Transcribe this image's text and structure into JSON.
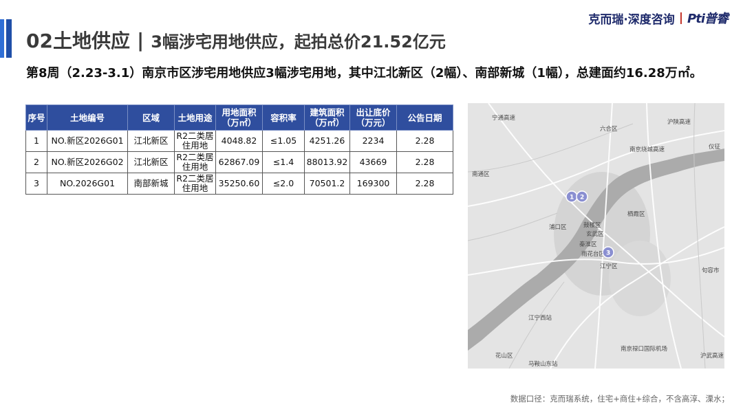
{
  "brand": {
    "name": "克而瑞·深度咨询",
    "separator": "|",
    "logo": "Pti普睿"
  },
  "title": {
    "prefix": "02土地供应",
    "separator": "|",
    "main": "3幅涉宅用地供应，起拍总价21.52亿元"
  },
  "summary": "第8周（2.23-3.1）南京市区涉宅用地供应3幅涉宅用地，其中江北新区（2幅）、南部新城（1幅），总建面约16.28万㎡。",
  "table": {
    "headers": [
      "序号",
      "土地编号",
      "区域",
      "土地用途",
      "用地面积\n（万㎡）",
      "容积率",
      "建筑面积\n（万㎡）",
      "出让底价\n（万元）",
      "公告日期"
    ],
    "rows": [
      [
        "1",
        "NO.新区2026G01",
        "江北新区",
        "R2二类居住用地",
        "4048.82",
        "≤1.05",
        "4251.26",
        "2234",
        "2.28"
      ],
      [
        "2",
        "NO.新区2026G02",
        "江北新区",
        "R2二类居住用地",
        "62867.09",
        "≤1.4",
        "88013.92",
        "43669",
        "2.28"
      ],
      [
        "3",
        "NO.2026G01",
        "南部新城",
        "R2二类居住用地",
        "35250.60",
        "≤2.0",
        "70501.2",
        "169300",
        "2.28"
      ]
    ]
  },
  "map": {
    "markers": [
      {
        "label": "1",
        "color": "#8a8fd1"
      },
      {
        "label": "2",
        "color": "#8a8fd1"
      },
      {
        "label": "3",
        "color": "#8a8fd1"
      }
    ],
    "places": [
      "宁通高速",
      "沪陕高速",
      "六合区",
      "南京绕城高速",
      "南通区",
      "栖霞区",
      "浦口区",
      "鼓楼区",
      "玄武区",
      "秦淮区",
      "雨花台区",
      "江宁区",
      "花山区",
      "句容市",
      "仪征",
      "江宁西站",
      "南京禄口国际机场",
      "马鞍山东站",
      "沪武高速"
    ]
  },
  "footnote": "数据口径：克而瑞系统，住宅+商住+综合，不含高淳、溧水；",
  "colors": {
    "header_bg": "#2f4e9e",
    "accent": "#2f6fd6",
    "brand": "#1e2a6b",
    "brand_red": "#c0281e"
  }
}
